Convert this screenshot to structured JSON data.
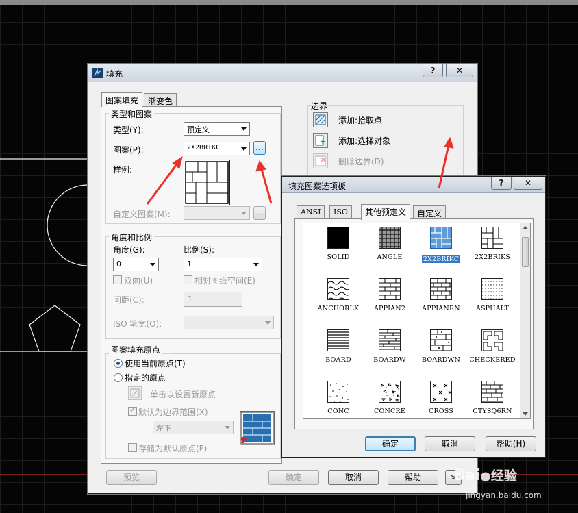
{
  "main_dialog": {
    "title": "填充",
    "help_btn": "?",
    "close_btn": "✕",
    "tabs": [
      "图案填充",
      "渐变色"
    ],
    "type_pattern": {
      "group_title": "类型和图案",
      "type_label": "类型(Y):",
      "type_value": "预定义",
      "pattern_label": "图案(P):",
      "pattern_value": "2X2BRIKC",
      "browse_btn": "...",
      "sample_label": "样例:",
      "custom_label": "自定义图案(M):",
      "custom_value": "",
      "custom_btn": "..."
    },
    "angle_scale": {
      "group_title": "角度和比例",
      "angle_label": "角度(G):",
      "angle_value": "0",
      "scale_label": "比例(S):",
      "scale_value": "1",
      "double_label": "双向(U)",
      "relative_label": "相对图纸空间(E)",
      "spacing_label": "间距(C):",
      "spacing_value": "1",
      "iso_label": "ISO 笔宽(O):",
      "iso_value": ""
    },
    "origin": {
      "group_title": "图案填充原点",
      "use_current": "使用当前原点(T)",
      "specified": "指定的原点",
      "click_set": "单击以设置新原点",
      "default_extent": "默认为边界范围(X)",
      "position_value": "左下",
      "store_default": "存储为默认原点(F)"
    },
    "boundary": {
      "group_title": "边界",
      "add_pick": "添加:拾取点",
      "add_select": "添加:选择对象",
      "remove": "删除边界(D)"
    },
    "footer": {
      "preview": "预览",
      "ok": "确定",
      "cancel": "取消",
      "help": "帮助",
      "expand": ">"
    }
  },
  "palette_dialog": {
    "title": "填充图案选项板",
    "help_btn": "?",
    "close_btn": "✕",
    "tabs": [
      "ANSI",
      "ISO",
      "其他预定义",
      "自定义"
    ],
    "active_tab": "其他预定义",
    "selected": "2X2BRIKC",
    "patterns": [
      {
        "name": "SOLID",
        "icon": "solid-fill"
      },
      {
        "name": "ANGLE",
        "icon": "angle-grid"
      },
      {
        "name": "2X2BRIKC",
        "icon": "brick-2x2"
      },
      {
        "name": "2X2BRIKS",
        "icon": "brick-2x2-s"
      },
      {
        "name": "ANCHORLK",
        "icon": "anchor-lock"
      },
      {
        "name": "APPIAN2",
        "icon": "appian-brick"
      },
      {
        "name": "APPIANRN",
        "icon": "appian-running"
      },
      {
        "name": "ASPHALT",
        "icon": "asphalt-dots"
      },
      {
        "name": "BOARD",
        "icon": "board-lines"
      },
      {
        "name": "BOARDW",
        "icon": "board-weave"
      },
      {
        "name": "BOARDWN",
        "icon": "board-weave-n"
      },
      {
        "name": "CHECKERED",
        "icon": "checkered"
      },
      {
        "name": "CONC",
        "icon": "concrete-dots"
      },
      {
        "name": "CONCRE",
        "icon": "concrete-chips"
      },
      {
        "name": "CROSS",
        "icon": "cross-marks"
      },
      {
        "name": "CTYSQ6RN",
        "icon": "city-square"
      }
    ],
    "ok": "确定",
    "cancel": "取消",
    "help": "帮助(H)"
  },
  "watermark": {
    "brand": "Bai",
    "brand2": "经验",
    "url": "jingyan.baidu.com"
  },
  "colors": {
    "cad_background": "#050505",
    "dialog_face": "#f0f0f0",
    "selection_blue": "#3378c9",
    "annotation_red": "#e8322b"
  }
}
